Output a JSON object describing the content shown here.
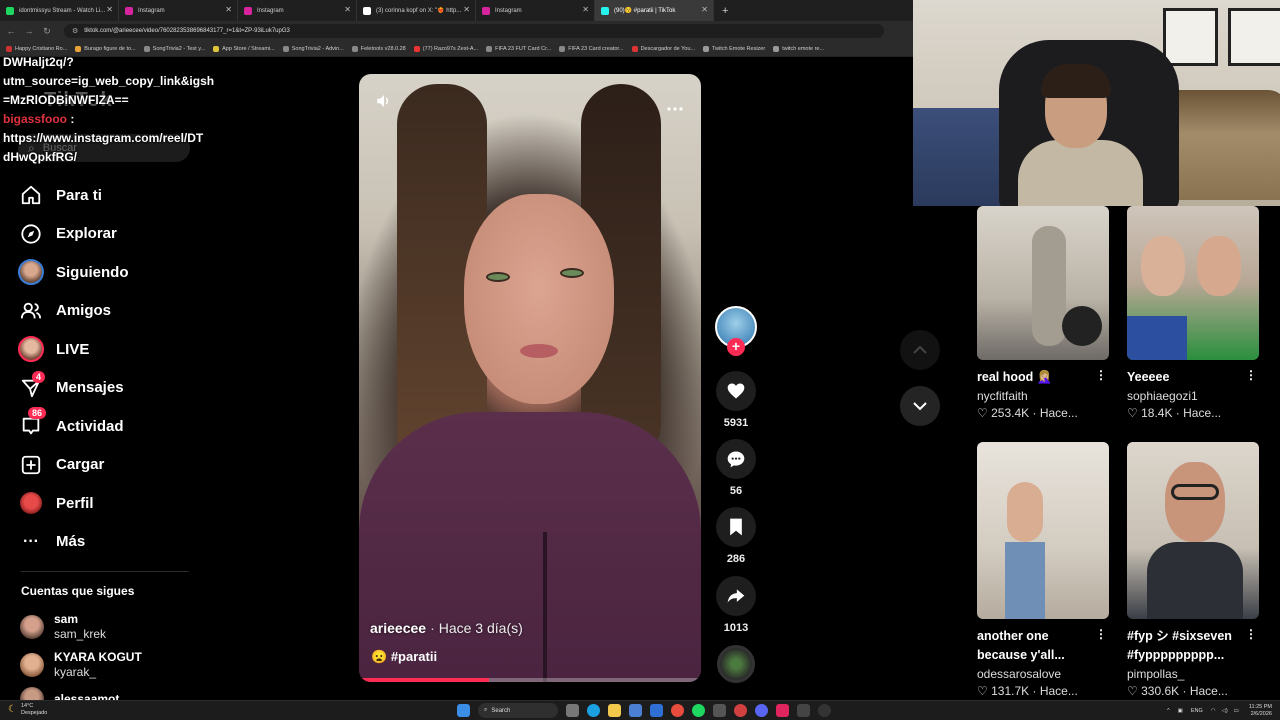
{
  "browser": {
    "tabs": [
      {
        "title": "idontmissyu Stream - Watch Li...",
        "color": "#1ed760"
      },
      {
        "title": "Instagram",
        "color": "#d6249f"
      },
      {
        "title": "Instagram",
        "color": "#d6249f"
      },
      {
        "title": "(3) corinna kopf on X: \"❤️‍🔥 http...",
        "color": "#ffffff"
      },
      {
        "title": "Instagram",
        "color": "#d6249f"
      },
      {
        "title": "(90)😚 #paratii | TikTok",
        "color": "#25f4ee"
      }
    ],
    "new_tab": "+",
    "url": "tiktok.com/@arieecee/video/7602823538696843177_r=1&t=ZP-93iLuk7upG3",
    "bookmarks": [
      "Happy Cristiano Ro...",
      "Burago figure de to...",
      "SongTrivia2 - Test y...",
      "App Store / Streami...",
      "SongTrivia2 - Advin...",
      "Feletools v28.0.28",
      "(77) Razo97s Zest-A...",
      "FIFA 23 FUT Card Cr...",
      "FIFA 23 Card creator...",
      "Descargador de You...",
      "Twitch Emote Resizer",
      "twitch emote re..."
    ]
  },
  "chat": {
    "line1": "DWHaljt2q/?",
    "line2": "utm_source=ig_web_copy_link&igsh",
    "line3": "=MzRlODBiNWFlZA==",
    "username": "bigassfooo",
    "colon": " :",
    "line4": "https://www.instagram.com/reel/DT",
    "line5": "dHwQpkfRG/"
  },
  "tiktok": {
    "wordmark": "TikTok",
    "search_placeholder": "Buscar",
    "nav": [
      {
        "label": "Para ti",
        "icon": "home-icon"
      },
      {
        "label": "Explorar",
        "icon": "compass-icon"
      },
      {
        "label": "Siguiendo",
        "icon": "following-avatar-icon"
      },
      {
        "label": "Amigos",
        "icon": "friends-icon"
      },
      {
        "label": "LIVE",
        "icon": "live-avatar-icon"
      },
      {
        "label": "Mensajes",
        "icon": "send-icon",
        "badge": "4"
      },
      {
        "label": "Actividad",
        "icon": "inbox-icon",
        "badge": "86"
      },
      {
        "label": "Cargar",
        "icon": "upload-icon"
      },
      {
        "label": "Perfil",
        "icon": "profile-avatar-icon"
      },
      {
        "label": "Más",
        "icon": "more-icon"
      }
    ],
    "following_title": "Cuentas que sigues",
    "following": [
      {
        "name": "sam",
        "handle": "sam_krek"
      },
      {
        "name": "KYARA KOGUT",
        "handle": "kyarak_"
      },
      {
        "name": "alessaamot",
        "handle": ""
      }
    ],
    "video": {
      "author": "arieecee",
      "separator": "·",
      "time": "Hace 3 día(s)",
      "caption_emoji": "😦",
      "caption": "#paratii",
      "progress": 0.38
    },
    "actions": {
      "likes": "5931",
      "comments": "56",
      "saves": "286",
      "shares": "1013",
      "follow": "+"
    },
    "grid": [
      {
        "title": "real hood 🤦🏼‍♀️",
        "user": "nycfitfaith",
        "views": "253.4K",
        "ago": "Hace..."
      },
      {
        "title": "Yeeeee",
        "user": "sophiaegozi1",
        "views": "18.4K",
        "ago": "Hace..."
      },
      {
        "title": "another one because y'all...",
        "user": "odessarosalove",
        "views": "131.7K",
        "ago": "Hace..."
      },
      {
        "title": "#fyp シ #sixseven #fyppppppppp...",
        "user": "pimpollas_",
        "views": "330.6K",
        "ago": "Hace..."
      }
    ]
  },
  "taskbar": {
    "temp": "14°C",
    "weather": "Despejado",
    "search": "Search",
    "lang": "ENG",
    "time": "11:25 PM",
    "date": "2/6/2026"
  },
  "colors": {
    "accent": "#fe2c55",
    "background": "#000000"
  }
}
